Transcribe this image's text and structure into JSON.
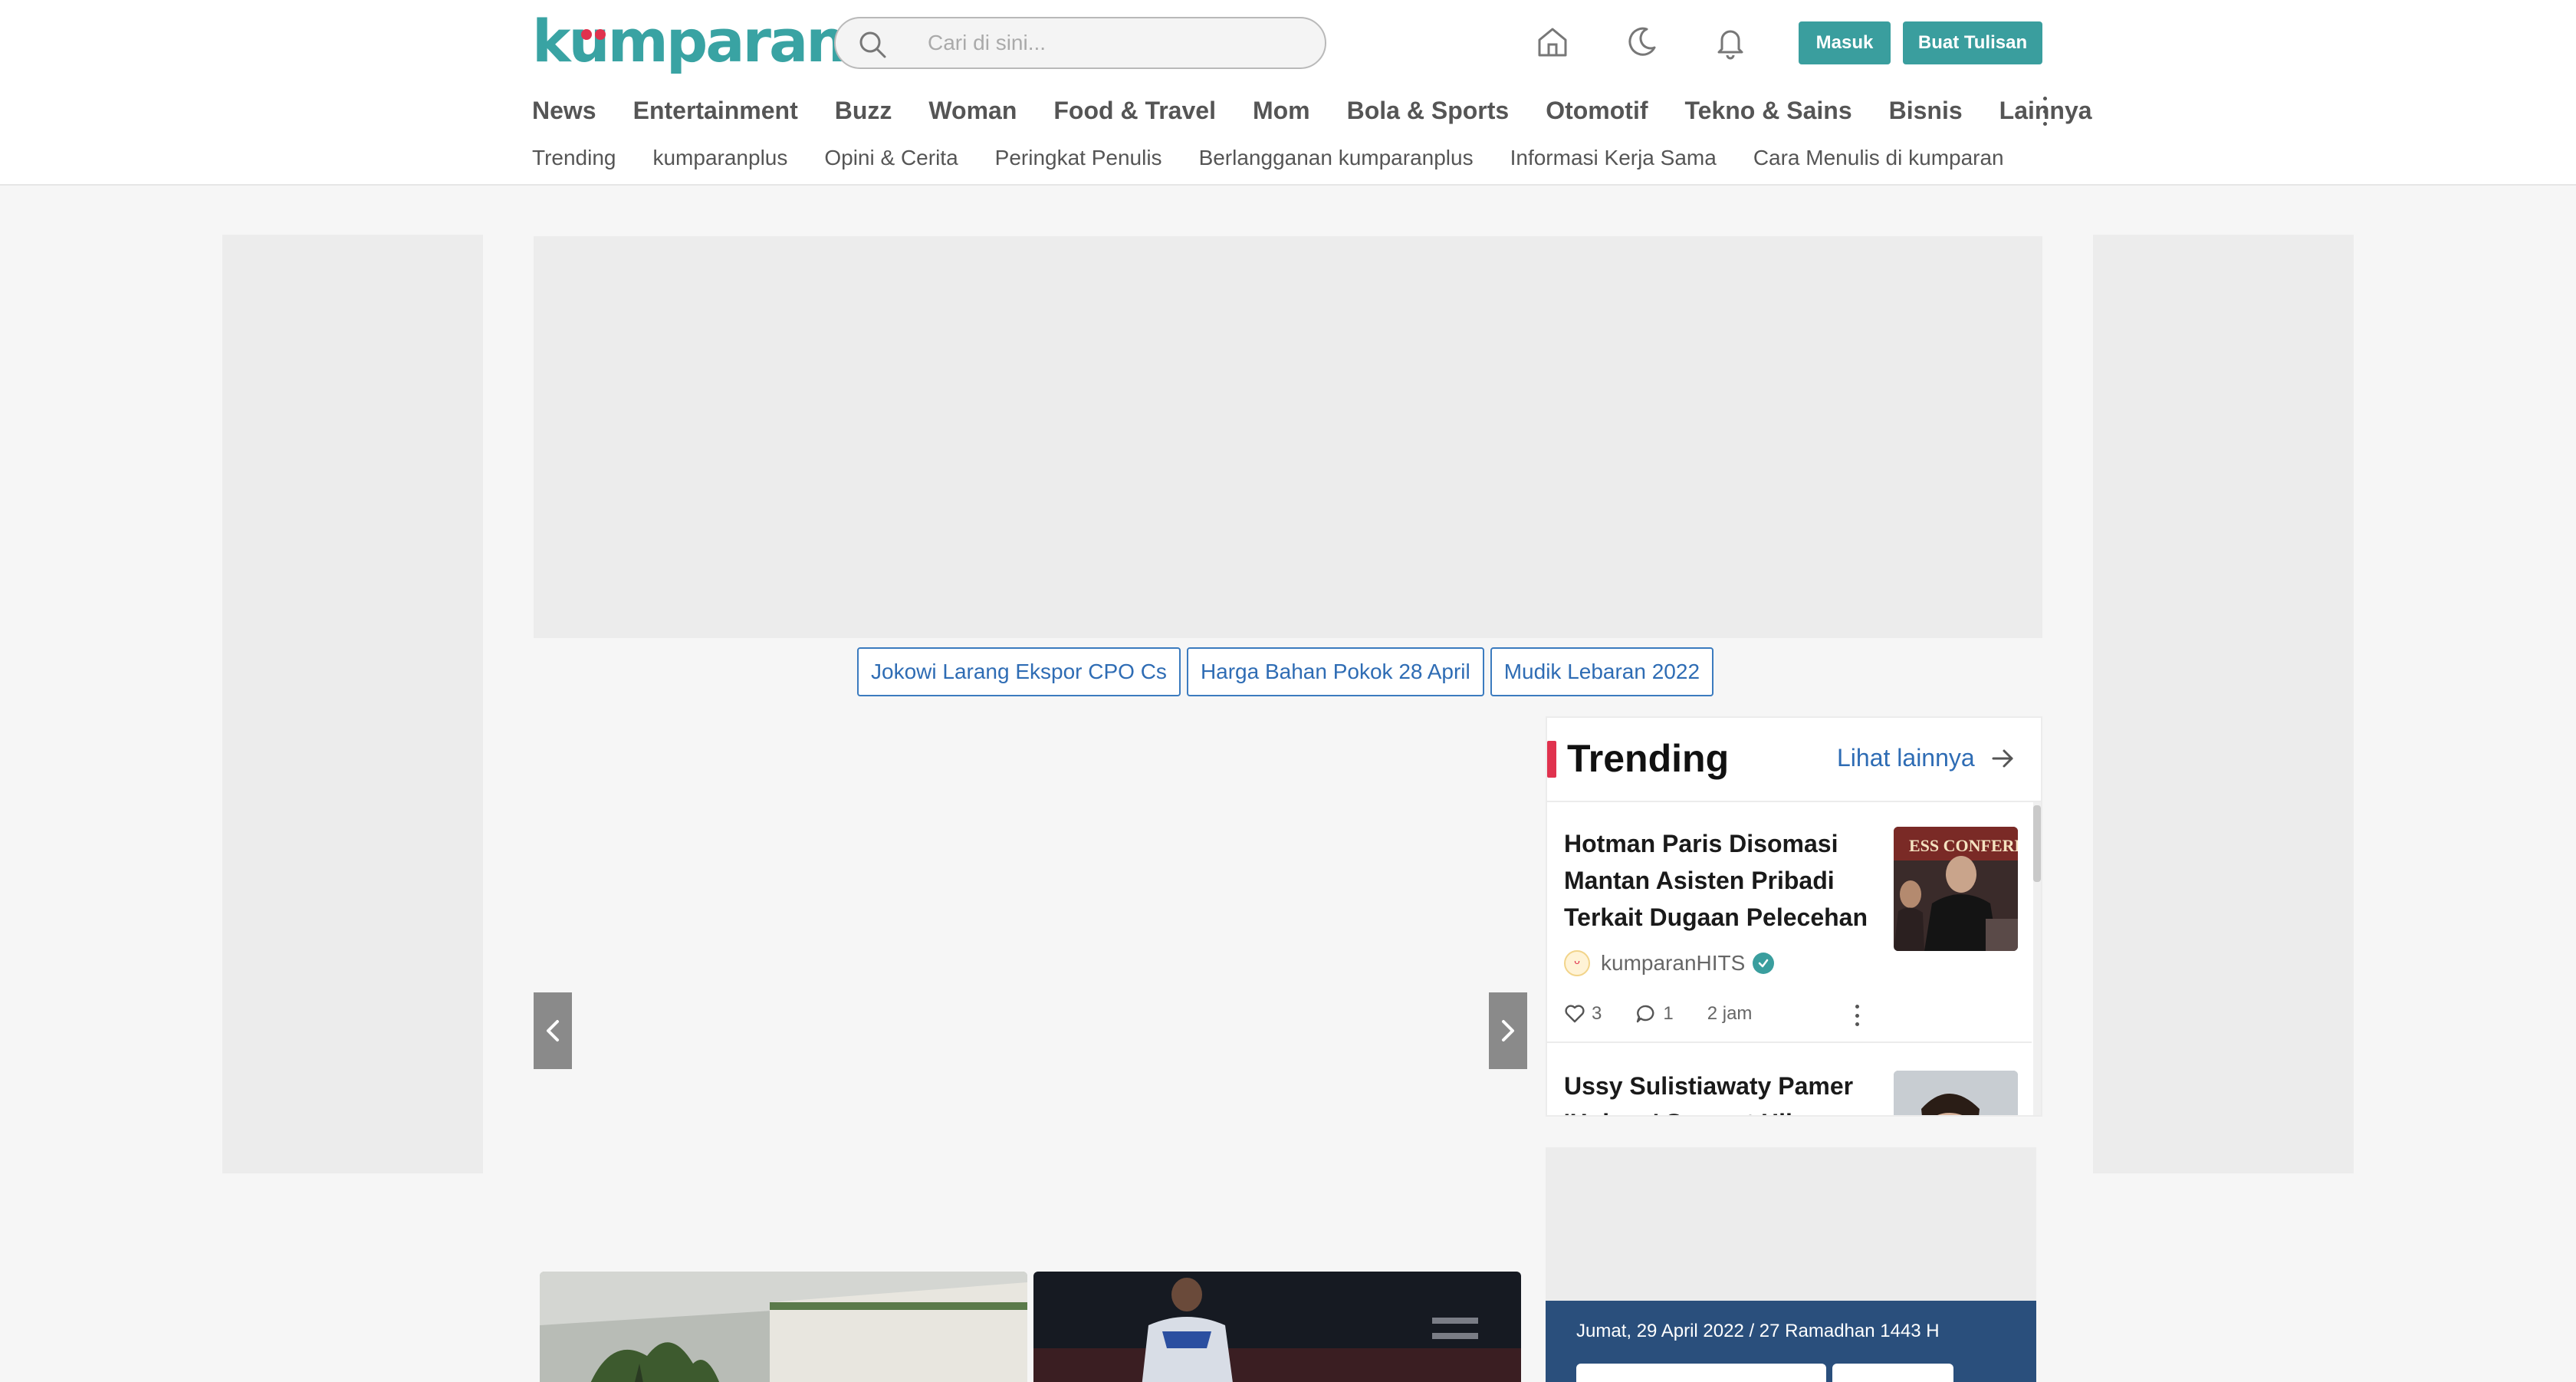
{
  "header": {
    "logo_text": "kumparan",
    "search_placeholder": "Cari di sini...",
    "login_label": "Masuk",
    "write_label": "Buat Tulisan",
    "icons": [
      "home-icon",
      "moon-icon",
      "bell-icon"
    ]
  },
  "nav": {
    "items": [
      "News",
      "Entertainment",
      "Buzz",
      "Woman",
      "Food & Travel",
      "Mom",
      "Bola & Sports",
      "Otomotif",
      "Tekno & Sains",
      "Bisnis",
      "Lainnya"
    ]
  },
  "subnav": {
    "items": [
      "Trending",
      "kumparanplus",
      "Opini & Cerita",
      "Peringkat Penulis",
      "Berlangganan kumparanplus",
      "Informasi Kerja Sama",
      "Cara Menulis di kumparan"
    ]
  },
  "topics": [
    "Jokowi Larang Ekspor CPO Cs",
    "Harga Bahan Pokok 28 April",
    "Mudik Lebaran 2022"
  ],
  "trending": {
    "title": "Trending",
    "more_label": "Lihat lainnya",
    "items": [
      {
        "title": "Hotman Paris Disomasi Mantan Asisten Pribadi Terkait Dugaan Pelecehan",
        "author": "kumparanHITS",
        "likes": "3",
        "comments": "1",
        "time": "2 jam"
      },
      {
        "title": "Ussy Sulistiawaty Pamer 'Hukum' Sempat Hilang Dari",
        "author": "",
        "likes": "",
        "comments": "",
        "time": ""
      }
    ]
  },
  "prayer": {
    "date": "Jumat, 29 April 2022 / 27 Ramadhan 1443 H"
  },
  "colors": {
    "brand": "#39a3a3",
    "accent_red": "#e0324e",
    "link_blue": "#2e6cb4",
    "prayer_bg": "#2a4f7c"
  }
}
